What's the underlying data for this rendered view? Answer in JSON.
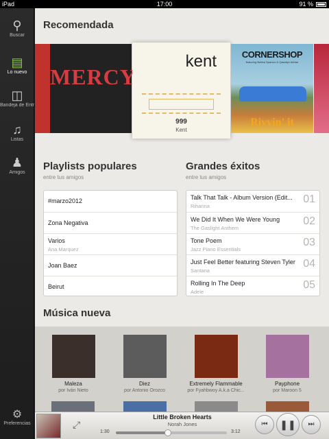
{
  "status": {
    "device": "iPad",
    "time": "17:00",
    "battery": "91 %"
  },
  "sidebar": {
    "items": [
      {
        "label": "Buscar",
        "icon": "search-icon"
      },
      {
        "label": "Lo nuevo",
        "icon": "whats-new-icon"
      },
      {
        "label": "Bandeja de Entrada",
        "icon": "inbox-icon"
      },
      {
        "label": "Listas",
        "icon": "music-note-icon"
      },
      {
        "label": "Amigos",
        "icon": "friends-icon"
      }
    ],
    "preferences_label": "Preferencias"
  },
  "recommended": {
    "title": "Recomendada",
    "mercy_text": "MERCY",
    "kent_logo": "kent",
    "kent_album": "999",
    "kent_artist": "Kent",
    "cornershop_title": "CORNERSHOP",
    "cornershop_sub": "featuring Bubba Sparxxx & Qawalyn Akhtar",
    "cornershop_bottom": "Rivvin' it"
  },
  "playlists": {
    "title": "Playlists populares",
    "subtitle": "entre tus amigos",
    "items": [
      {
        "title": "#marzo2012",
        "sub": ""
      },
      {
        "title": "Zona Negativa",
        "sub": ""
      },
      {
        "title": "Varios",
        "sub": "Ana Marquez"
      },
      {
        "title": "Joan Baez",
        "sub": ""
      },
      {
        "title": "Beirut",
        "sub": ""
      }
    ]
  },
  "hits": {
    "title": "Grandes éxitos",
    "subtitle": "entre tus amigos",
    "items": [
      {
        "title": "Talk That Talk - Album Version (Edit...",
        "sub": "Rihanna",
        "num": "01"
      },
      {
        "title": "We Did It When We Were Young",
        "sub": "The Gaslight Anthem",
        "num": "02"
      },
      {
        "title": "Tone Poem",
        "sub": "Jazz Piano Essentials",
        "num": "03"
      },
      {
        "title": "Just Feel Better featuring Steven Tyler",
        "sub": "Santana",
        "num": "04"
      },
      {
        "title": "Rolling In The Deep",
        "sub": "Adele",
        "num": "05"
      }
    ]
  },
  "new_music": {
    "title": "Música nueva",
    "albums": [
      {
        "title": "Maleza",
        "artist": "por Iván Nieto",
        "color": "#3a2f2a"
      },
      {
        "title": "Diez",
        "artist": "por Antonio Orozco",
        "color": "#5c5c5c"
      },
      {
        "title": "Extremely Flammable",
        "artist": "por Fyahbwoy A.k.a Chic...",
        "color": "#7a2a12"
      },
      {
        "title": "Payphone",
        "artist": "por Maroon 5",
        "color": "#a5729f"
      }
    ]
  },
  "player": {
    "song": "Little Broken Hearts",
    "artist": "Norah Jones",
    "elapsed": "1:30",
    "total": "3:12",
    "progress": 0.47
  }
}
